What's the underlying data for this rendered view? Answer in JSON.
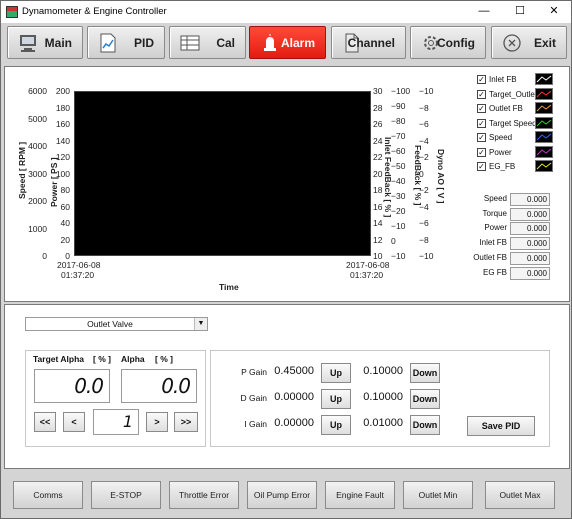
{
  "window": {
    "title": "Dynamometer & Engine Controller",
    "minimize": "—",
    "maximize": "☐",
    "close": "✕"
  },
  "nav": {
    "buttons": [
      {
        "label": "Main",
        "icon": "computer-icon"
      },
      {
        "label": "PID",
        "icon": "document-chart-icon"
      },
      {
        "label": "Cal",
        "icon": "grid-icon"
      },
      {
        "label": "Alarm",
        "icon": "alarm-light-icon",
        "active": true
      },
      {
        "label": "Channel",
        "icon": "page-icon"
      },
      {
        "label": "Config",
        "icon": "gear-icon"
      },
      {
        "label": "Exit",
        "icon": "exit-circle-icon"
      }
    ],
    "active_color": "#e8261a"
  },
  "chart_data": {
    "type": "line",
    "plot_background": "#000000",
    "xlabel": "Time",
    "x_range": [
      "2017-06-08 01:37:20",
      "2017-06-08 01:37:20"
    ],
    "x_ticks": [
      {
        "date": "2017-06-08",
        "time": "01:37:20"
      },
      {
        "date": "2017-06-08",
        "time": "01:37:20"
      }
    ],
    "left_axes": [
      {
        "label": "Speed [ RPM ]",
        "ylim": [
          0,
          6000
        ],
        "ticks": [
          "6000",
          "5000",
          "4000",
          "3000",
          "2000",
          "1000",
          "0"
        ]
      },
      {
        "label": "Power [ PS ]",
        "ylim": [
          0,
          200
        ],
        "ticks": [
          "200",
          "180",
          "160",
          "140",
          "120",
          "100",
          "80",
          "60",
          "40",
          "20",
          "0"
        ]
      }
    ],
    "right_axes": [
      {
        "label": "Inlet FeedBack [ % ]",
        "ylim": [
          10,
          30
        ],
        "ticks": [
          "30",
          "28",
          "26",
          "24",
          "22",
          "20",
          "18",
          "16",
          "14",
          "12",
          "10"
        ]
      },
      {
        "label": "FeedBack [ % ]",
        "ylim": [
          -10,
          100
        ],
        "ticks": [
          "−100",
          "−90",
          "−80",
          "−70",
          "−60",
          "−50",
          "−40",
          "−30",
          "−20",
          "−10",
          "0",
          "−10"
        ]
      },
      {
        "label": "Dyno AO [ V ]",
        "ylim": [
          -10,
          10
        ],
        "ticks": [
          "−10",
          "−8",
          "−6",
          "−4",
          "−2",
          "0",
          "−2",
          "−4",
          "−6",
          "−8",
          "−10"
        ]
      }
    ],
    "series": []
  },
  "legend": [
    {
      "label": "Inlet FB",
      "checked": true,
      "color": "#ffffff"
    },
    {
      "label": "Target_Outlet",
      "checked": true,
      "color": "#ff3333"
    },
    {
      "label": "Outlet FB",
      "checked": true,
      "color": "#ff9933"
    },
    {
      "label": "Target Speed",
      "checked": true,
      "color": "#33cc33"
    },
    {
      "label": "Speed",
      "checked": true,
      "color": "#3366ff"
    },
    {
      "label": "Power",
      "checked": true,
      "color": "#cc33cc"
    },
    {
      "label": "EG_FB",
      "checked": true,
      "color": "#e6e633"
    }
  ],
  "readouts": [
    {
      "label": "Speed",
      "value": "0.000"
    },
    {
      "label": "Torque",
      "value": "0.000"
    },
    {
      "label": "Power",
      "value": "0.000"
    },
    {
      "label": "Inlet FB",
      "value": "0.000"
    },
    {
      "label": "Outlet FB",
      "value": "0.000"
    },
    {
      "label": "EG FB",
      "value": "0.000"
    }
  ],
  "pid": {
    "valve_select": "Outlet Valve",
    "target_alpha_label": "Target Alpha",
    "target_alpha_unit": "[ % ]",
    "alpha_label": "Alpha",
    "alpha_unit": "[ % ]",
    "target_alpha_value": "0.0",
    "alpha_value": "0.0",
    "step_value": "1",
    "btn_fast_back": "<<",
    "btn_back": "<",
    "btn_fwd": ">",
    "btn_fast_fwd": ">>",
    "gains": [
      {
        "label": "P Gain",
        "value": "0.45000",
        "step": "0.10000"
      },
      {
        "label": "D Gain",
        "value": "0.00000",
        "step": "0.10000"
      },
      {
        "label": "I Gain",
        "value": "0.00000",
        "step": "0.01000"
      }
    ],
    "up_label": "Up",
    "down_label": "Down",
    "save_label": "Save PID"
  },
  "status_buttons": [
    "Comms",
    "E-STOP",
    "Throttle Error",
    "Oil Pump Error",
    "Engine Fault",
    "Outlet Min",
    "Outlet Max"
  ]
}
